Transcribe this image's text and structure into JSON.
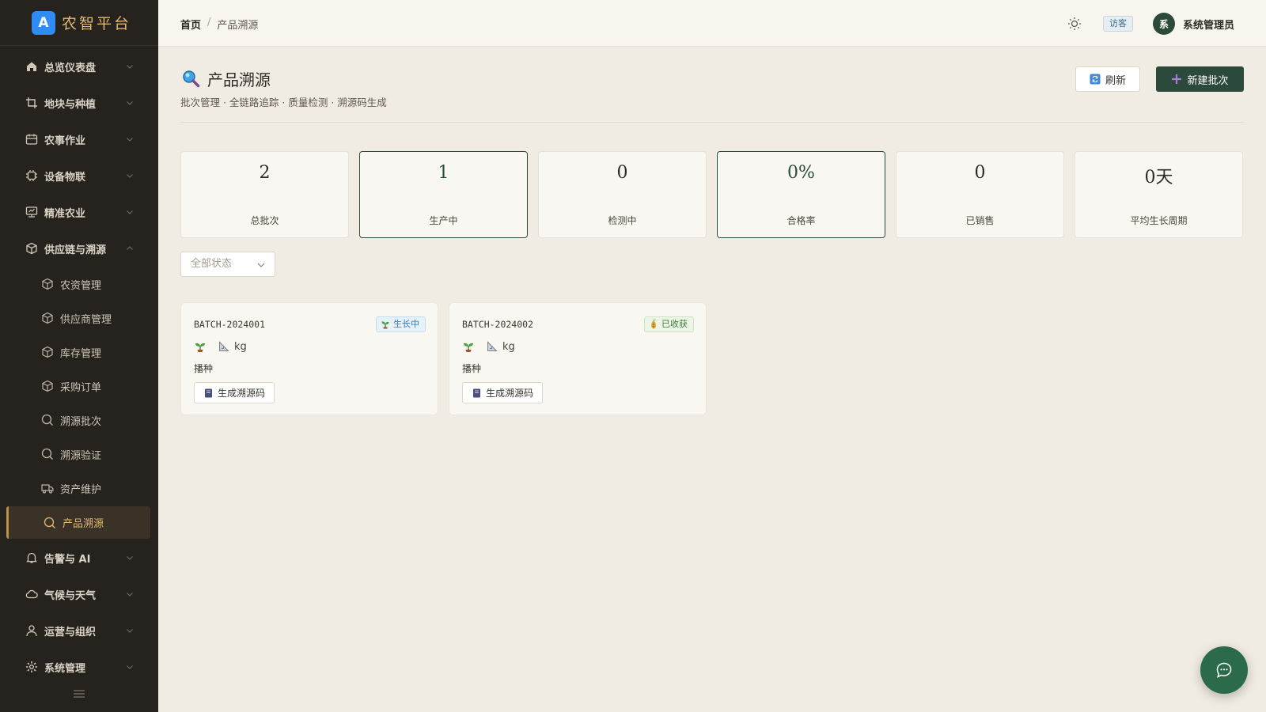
{
  "brand": {
    "logo_letter": "A",
    "name": "农智平台"
  },
  "sidebar": {
    "groups_top": [
      {
        "label": "总览仪表盘",
        "icon": "home-icon"
      },
      {
        "label": "地块与种植",
        "icon": "crop-icon"
      },
      {
        "label": "农事作业",
        "icon": "calendar-icon"
      },
      {
        "label": "设备物联",
        "icon": "chip-icon"
      },
      {
        "label": "精准农业",
        "icon": "monitor-icon"
      },
      {
        "label": "供应链与溯源",
        "icon": "package-icon",
        "expanded": true
      }
    ],
    "sub_items": [
      {
        "label": "农资管理",
        "icon": "package-icon"
      },
      {
        "label": "供应商管理",
        "icon": "package-icon"
      },
      {
        "label": "库存管理",
        "icon": "package-icon"
      },
      {
        "label": "采购订单",
        "icon": "package-icon"
      },
      {
        "label": "溯源批次",
        "icon": "search-icon"
      },
      {
        "label": "溯源验证",
        "icon": "search-icon"
      },
      {
        "label": "资产维护",
        "icon": "truck-icon"
      },
      {
        "label": "产品溯源",
        "icon": "search-icon",
        "active": true
      }
    ],
    "groups_bottom": [
      {
        "label": "告警与 AI",
        "icon": "bell-icon"
      },
      {
        "label": "气候与天气",
        "icon": "cloud-icon"
      },
      {
        "label": "运营与组织",
        "icon": "user-icon"
      },
      {
        "label": "系统管理",
        "icon": "gear-icon"
      }
    ]
  },
  "header": {
    "breadcrumb_home": "首页",
    "breadcrumb_separator": "/",
    "breadcrumb_current": "产品溯源",
    "guest_badge": "访客",
    "avatar_letter": "系",
    "user_name": "系统管理员"
  },
  "page": {
    "title": "产品溯源",
    "subtitle": "批次管理 · 全链路追踪 · 质量检测 · 溯源码生成",
    "refresh_label": "刷新",
    "new_batch_label": "新建批次"
  },
  "stats": [
    {
      "value": "2",
      "label": "总批次",
      "highlight": false
    },
    {
      "value": "1",
      "label": "生产中",
      "highlight": true
    },
    {
      "value": "0",
      "label": "检测中",
      "highlight": false
    },
    {
      "value": "0%",
      "label": "合格率",
      "highlight": true
    },
    {
      "value": "0",
      "label": "已销售",
      "highlight": false
    },
    {
      "value": "0天",
      "label": "平均生长周期",
      "highlight": false
    }
  ],
  "filter": {
    "status_placeholder": "全部状态"
  },
  "batches": [
    {
      "code": "BATCH-2024001",
      "status": "生长中",
      "status_color": "#2f7bbf",
      "unit": "kg",
      "stage": "播种",
      "qr_label": "生成溯源码"
    },
    {
      "code": "BATCH-2024002",
      "status": "已收获",
      "status_color": "#3e7a35",
      "unit": "kg",
      "stage": "播种",
      "qr_label": "生成溯源码"
    }
  ],
  "colors": {
    "sidebar_bg": "#26231f",
    "accent_gold": "#e2b873",
    "primary_green": "#2c4a3b",
    "page_bg": "#f1ece3"
  }
}
